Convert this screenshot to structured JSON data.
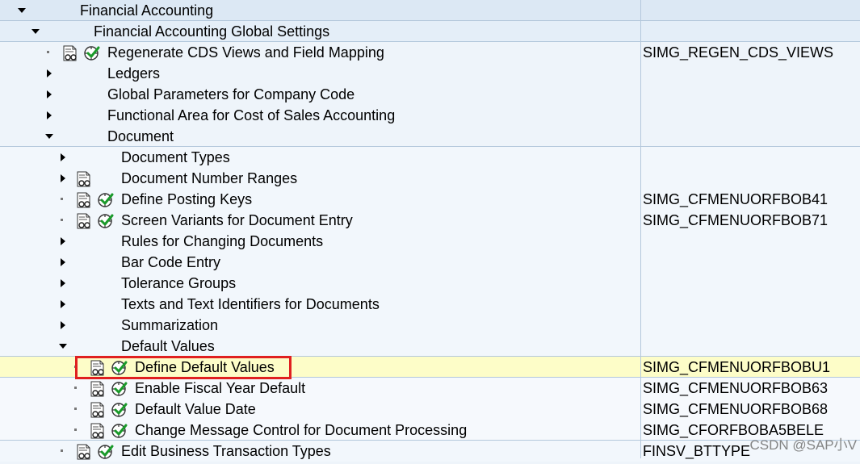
{
  "tree": [
    {
      "label": "Financial Accounting",
      "code": "",
      "level": 0,
      "state": "open",
      "doc": false,
      "exec": false,
      "band": "l0",
      "line_after": true
    },
    {
      "label": "Financial Accounting Global Settings",
      "code": "",
      "level": 1,
      "state": "open",
      "doc": false,
      "exec": false,
      "band": "l1",
      "line_after": true
    },
    {
      "label": "Regenerate CDS Views and Field Mapping",
      "code": "SIMG_REGEN_CDS_VIEWS",
      "level": 2,
      "state": "leaf",
      "doc": true,
      "exec": true,
      "band": "l2"
    },
    {
      "label": "Ledgers",
      "code": "",
      "level": 2,
      "state": "closed",
      "doc": false,
      "exec": false,
      "band": "l2"
    },
    {
      "label": "Global Parameters for Company Code",
      "code": "",
      "level": 2,
      "state": "closed",
      "doc": false,
      "exec": false,
      "band": "l2"
    },
    {
      "label": "Functional Area for Cost of Sales Accounting",
      "code": "",
      "level": 2,
      "state": "closed",
      "doc": false,
      "exec": false,
      "band": "l2"
    },
    {
      "label": "Document",
      "code": "",
      "level": 2,
      "state": "open",
      "doc": false,
      "exec": false,
      "band": "l2",
      "line_after": true
    },
    {
      "label": "Document Types",
      "code": "",
      "level": 3,
      "state": "closed",
      "doc": false,
      "exec": false,
      "band": "l3"
    },
    {
      "label": "Document Number Ranges",
      "code": "",
      "level": 3,
      "state": "closed",
      "doc": true,
      "exec": false,
      "band": "l3"
    },
    {
      "label": "Define Posting Keys",
      "code": "SIMG_CFMENUORFBOB41",
      "level": 3,
      "state": "leaf",
      "doc": true,
      "exec": true,
      "band": "l3"
    },
    {
      "label": "Screen Variants for Document Entry",
      "code": "SIMG_CFMENUORFBOB71",
      "level": 3,
      "state": "leaf",
      "doc": true,
      "exec": true,
      "band": "l3"
    },
    {
      "label": "Rules for Changing Documents",
      "code": "",
      "level": 3,
      "state": "closed",
      "doc": false,
      "exec": false,
      "band": "l3"
    },
    {
      "label": "Bar Code Entry",
      "code": "",
      "level": 3,
      "state": "closed",
      "doc": false,
      "exec": false,
      "band": "l3"
    },
    {
      "label": "Tolerance Groups",
      "code": "",
      "level": 3,
      "state": "closed",
      "doc": false,
      "exec": false,
      "band": "l3"
    },
    {
      "label": "Texts and Text Identifiers for Documents",
      "code": "",
      "level": 3,
      "state": "closed",
      "doc": false,
      "exec": false,
      "band": "l3"
    },
    {
      "label": "Summarization",
      "code": "",
      "level": 3,
      "state": "closed",
      "doc": false,
      "exec": false,
      "band": "l3"
    },
    {
      "label": "Default Values",
      "code": "",
      "level": 3,
      "state": "open",
      "doc": false,
      "exec": false,
      "band": "l3",
      "line_after": true
    },
    {
      "label": "Define Default Values",
      "code": "SIMG_CFMENUORFBOBU1",
      "level": 4,
      "state": "leaf",
      "doc": true,
      "exec": true,
      "band": "sel",
      "selected": true,
      "line_after": true
    },
    {
      "label": "Enable Fiscal Year Default",
      "code": "SIMG_CFMENUORFBOB63",
      "level": 4,
      "state": "leaf",
      "doc": true,
      "exec": true,
      "band": "l4"
    },
    {
      "label": "Default Value Date",
      "code": "SIMG_CFMENUORFBOB68",
      "level": 4,
      "state": "leaf",
      "doc": true,
      "exec": true,
      "band": "l4"
    },
    {
      "label": "Change Message Control for Document Processing",
      "code": "SIMG_CFORFBOBA5BELE",
      "level": 4,
      "state": "leaf",
      "doc": true,
      "exec": true,
      "band": "l4",
      "line_after": true
    },
    {
      "label": "Edit Business Transaction Types",
      "code": "FINSV_BTTYPE",
      "level": 3,
      "state": "leaf",
      "doc": true,
      "exec": true,
      "band": "l3"
    }
  ],
  "icons": {
    "doc": "documentation-icon",
    "exec": "execute-activity-icon"
  },
  "colors": {
    "highlight": "#e02020",
    "selected_row": "#fdfdc8",
    "grid_line": "#b4c8dc"
  },
  "watermark": "CSDN @SAP小V"
}
